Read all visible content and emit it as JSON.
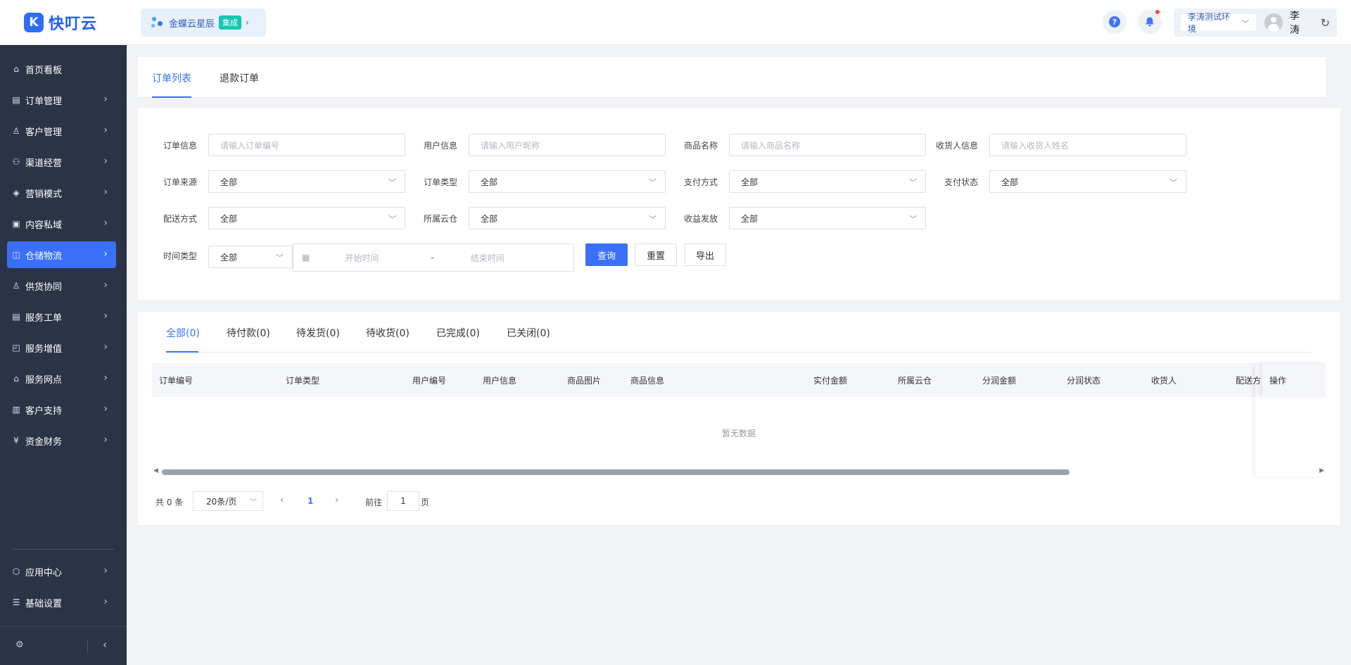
{
  "brand": {
    "name": "快叮云",
    "mark": "K"
  },
  "app_switch": {
    "name": "金蝶云星辰",
    "badge": "集成"
  },
  "header": {
    "help": "?",
    "env": "李涛测试环境",
    "user": "李涛"
  },
  "sidebar": {
    "items": [
      {
        "label": "首页看板",
        "icon": "home-icon"
      },
      {
        "label": "订单管理",
        "icon": "order-icon"
      },
      {
        "label": "客户管理",
        "icon": "user-icon"
      },
      {
        "label": "渠道经营",
        "icon": "channel-icon"
      },
      {
        "label": "营销模式",
        "icon": "tag-icon"
      },
      {
        "label": "内容私域",
        "icon": "image-icon"
      },
      {
        "label": "仓储物流",
        "icon": "warehouse-icon"
      },
      {
        "label": "供货协同",
        "icon": "supply-icon"
      },
      {
        "label": "服务工单",
        "icon": "ticket-icon"
      },
      {
        "label": "服务增值",
        "icon": "bag-icon"
      },
      {
        "label": "服务网点",
        "icon": "store-icon"
      },
      {
        "label": "客户支持",
        "icon": "support-icon"
      },
      {
        "label": "资金财务",
        "icon": "yen-icon"
      }
    ],
    "bottom": [
      {
        "label": "应用中心",
        "icon": "cube-icon"
      },
      {
        "label": "基础设置",
        "icon": "sliders-icon"
      }
    ]
  },
  "top_tabs": [
    "订单列表",
    "退款订单"
  ],
  "filters": {
    "row1": [
      {
        "label": "订单信息",
        "placeholder": "请输入订单编号"
      },
      {
        "label": "用户信息",
        "placeholder": "请输入用户昵称"
      },
      {
        "label": "商品名称",
        "placeholder": "请输入商品名称"
      },
      {
        "label": "收货人信息",
        "placeholder": "请输入收货人姓名"
      }
    ],
    "row2": [
      {
        "label": "订单来源",
        "value": "全部"
      },
      {
        "label": "订单类型",
        "value": "全部"
      },
      {
        "label": "支付方式",
        "value": "全部"
      },
      {
        "label": "支付状态",
        "value": "全部"
      }
    ],
    "row3": [
      {
        "label": "配送方式",
        "value": "全部"
      },
      {
        "label": "所属云仓",
        "value": "全部"
      },
      {
        "label": "收益发放",
        "value": "全部"
      }
    ],
    "time_label": "时间类型",
    "time_type": "全部",
    "start_placeholder": "开始时间",
    "range_sep": "-",
    "end_placeholder": "结束时间",
    "query": "查询",
    "reset": "重置",
    "export": "导出"
  },
  "order_tabs": [
    "全部(0)",
    "待付款(0)",
    "待发货(0)",
    "待收货(0)",
    "已完成(0)",
    "已关闭(0)"
  ],
  "table": {
    "columns": [
      "订单编号",
      "订单类型",
      "用户编号",
      "用户信息",
      "商品图片",
      "商品信息",
      "实付金额",
      "所属云仓",
      "分润金额",
      "分润状态",
      "收货人",
      "配送方",
      "操作"
    ],
    "empty": "暂无数据"
  },
  "pager": {
    "total": "共 0 条",
    "size": "20条/页",
    "current": "1",
    "goto": "前往",
    "page_input": "1",
    "page_unit": "页"
  }
}
